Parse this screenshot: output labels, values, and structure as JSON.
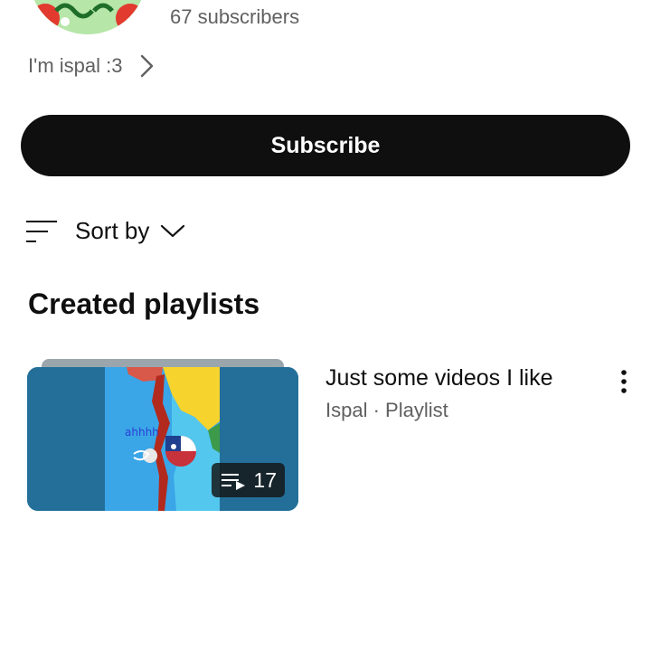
{
  "channel": {
    "subscribers": "67 subscribers",
    "description": "I'm ispal :3"
  },
  "actions": {
    "subscribe_label": "Subscribe"
  },
  "sort": {
    "label": "Sort by"
  },
  "section": {
    "title": "Created playlists"
  },
  "playlists": [
    {
      "title": "Just some videos I like",
      "meta": "Ispal · Playlist",
      "count": "17",
      "thumbnail_caption": "ahhhh"
    }
  ],
  "icons": {
    "about": "chevron-right-icon",
    "sort": "sort-lines-icon",
    "sort_toggle": "chevron-down-icon",
    "playlist": "playlist-play-icon",
    "more": "more-vert-icon"
  },
  "colors": {
    "button_bg": "#0f0f0f",
    "secondary_text": "#606060",
    "avatar_bg": "#b6e6a8"
  }
}
